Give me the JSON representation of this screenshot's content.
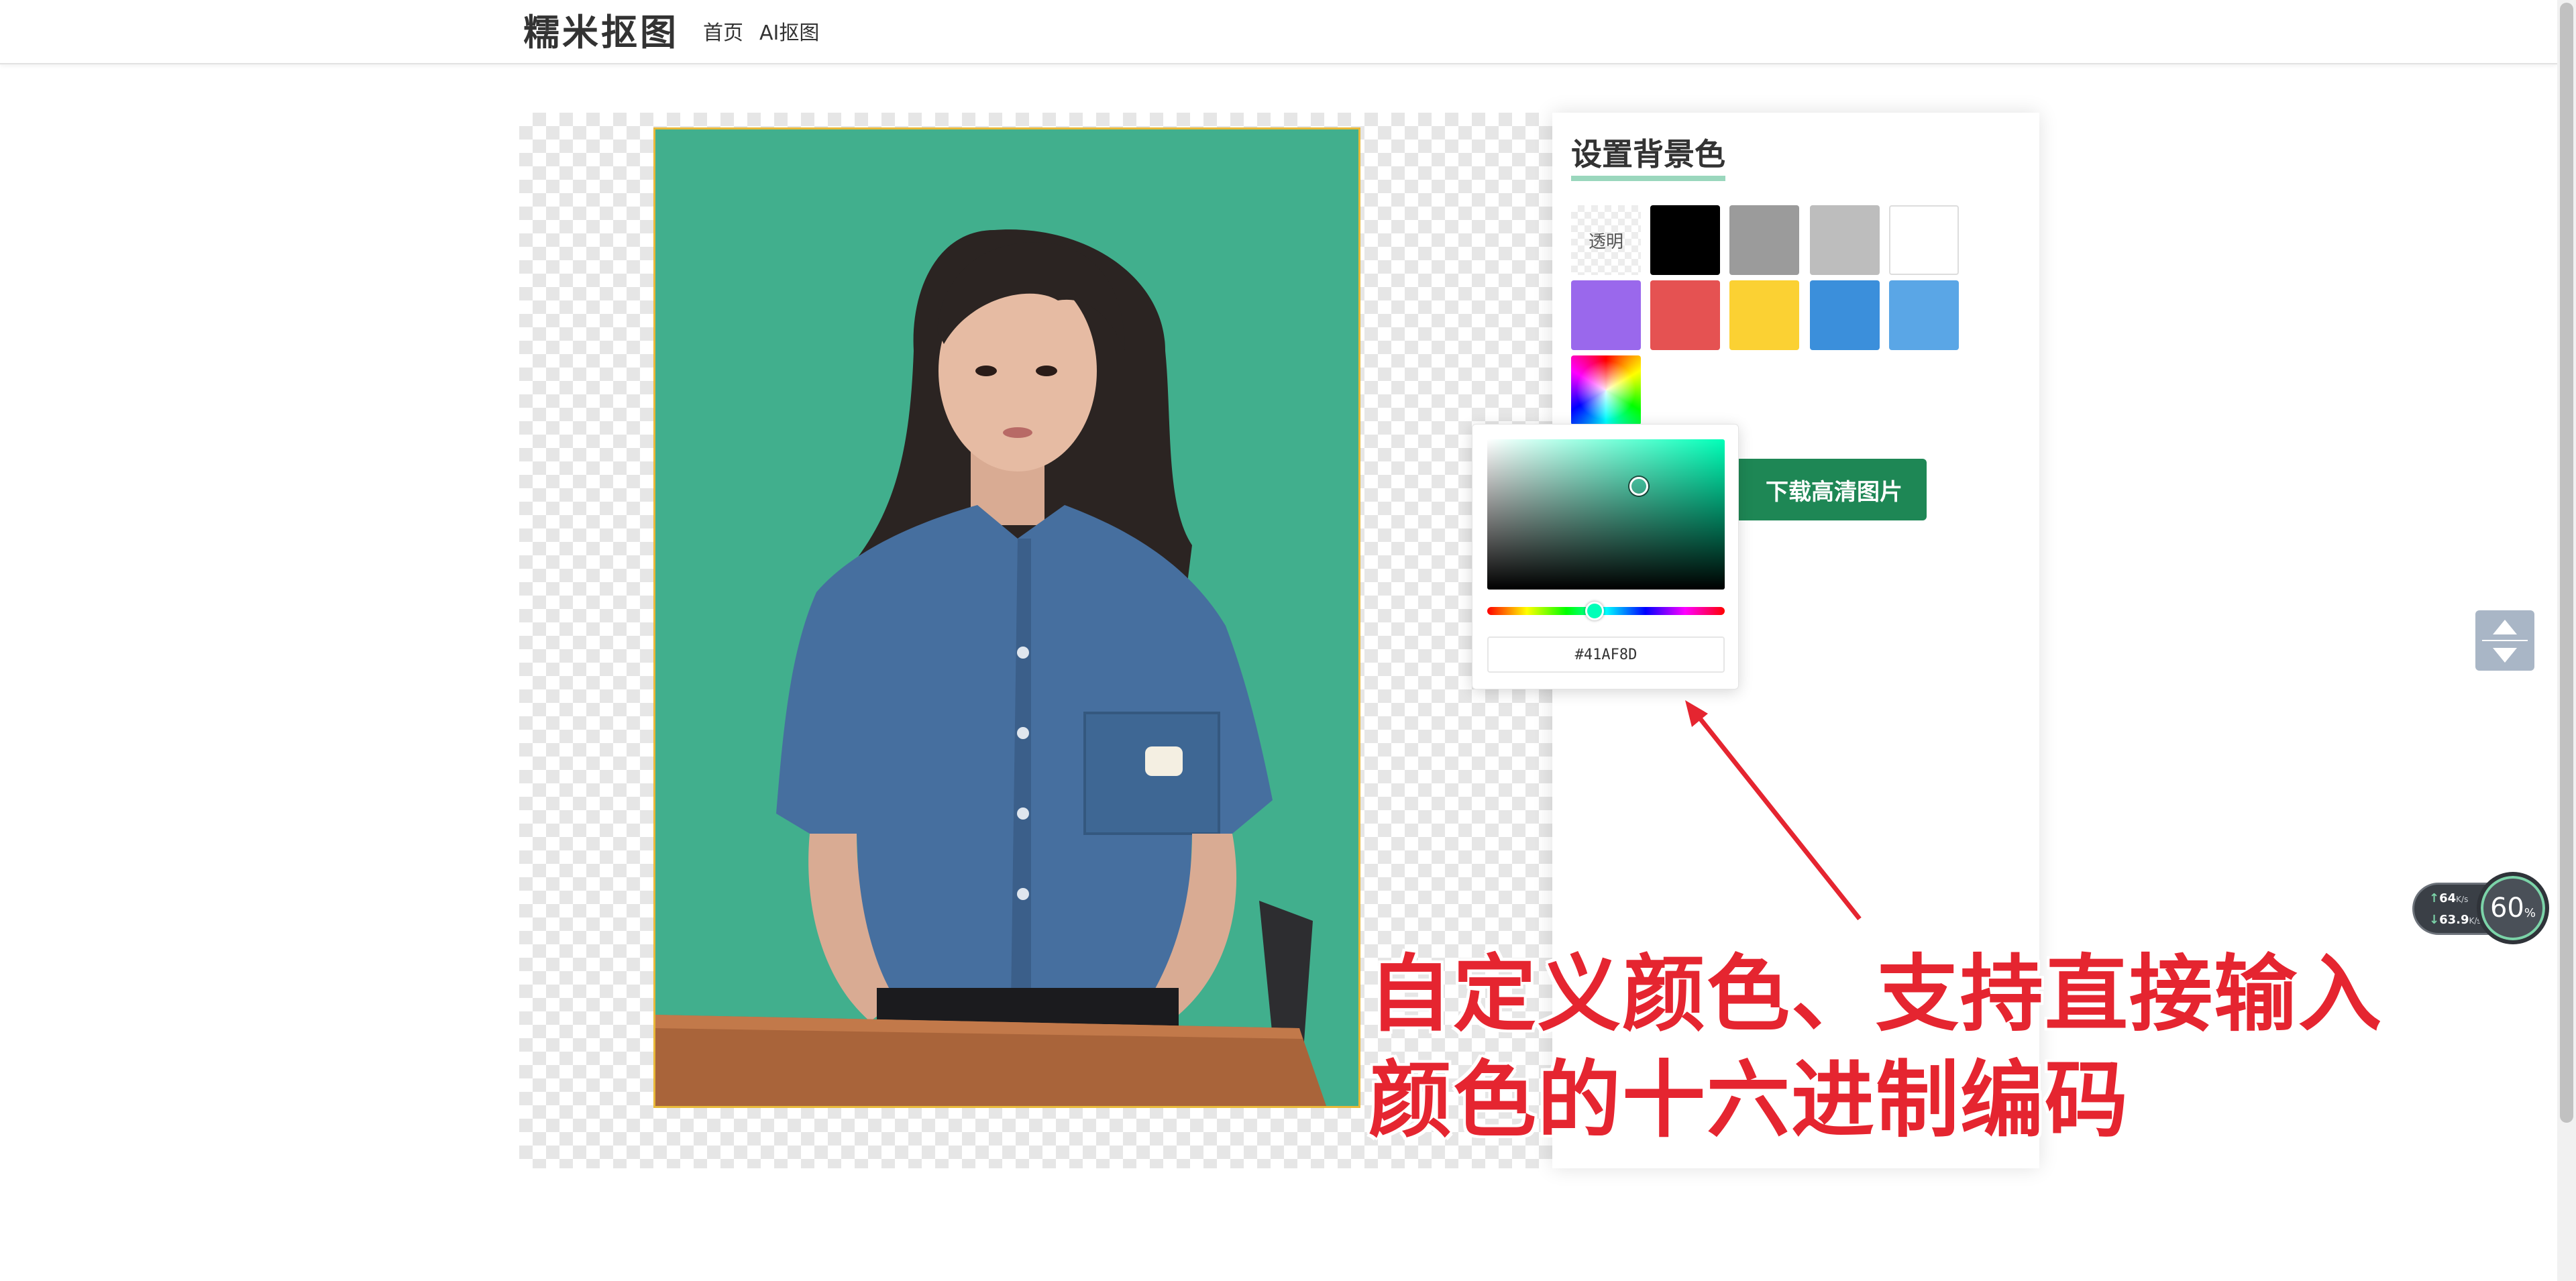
{
  "header": {
    "logo": "糯米抠图",
    "nav": [
      {
        "label": "首页"
      },
      {
        "label": "AI抠图"
      }
    ]
  },
  "panel": {
    "title": "设置背景色",
    "transparent_label": "透明",
    "swatch_colors": [
      "#000000",
      "#9b9b9b",
      "#bdbdbd",
      "#ffffff",
      "#9a68ec",
      "#e55252",
      "#fbd133",
      "#3b8fdb",
      "#5aa6e6"
    ],
    "download_label": "下载高清图片",
    "accent_color": "#1e8755"
  },
  "picker": {
    "hex_value": "#41AF8D"
  },
  "photo": {
    "background_color": "#41af8d"
  },
  "annotation": {
    "line1": "自定义颜色、支持直接输入",
    "line2": "颜色的十六进制编码",
    "color": "#e52530"
  },
  "net_widget": {
    "upload": "64",
    "upload_unit": "K/s",
    "download": "63.9",
    "download_unit": "K/s",
    "percent": "60",
    "percent_unit": "%"
  }
}
